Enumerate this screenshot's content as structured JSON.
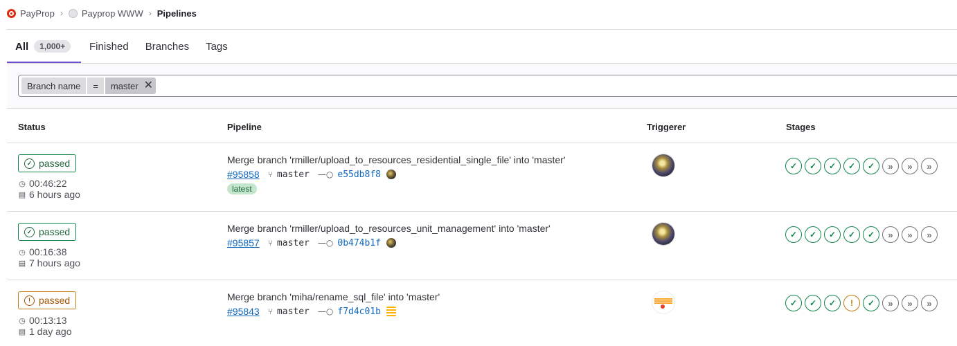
{
  "breadcrumb": {
    "group": "PayProp",
    "project": "Payprop WWW",
    "current": "Pipelines"
  },
  "tabs": [
    {
      "label": "All",
      "count": "1,000+"
    },
    {
      "label": "Finished"
    },
    {
      "label": "Branches"
    },
    {
      "label": "Tags"
    }
  ],
  "filter": {
    "token_name": "Branch name",
    "operator": "=",
    "value": "master"
  },
  "table": {
    "headers": {
      "status": "Status",
      "pipeline": "Pipeline",
      "triggerer": "Triggerer",
      "stages": "Stages"
    },
    "rows": [
      {
        "status": "passed",
        "duration": "00:46:22",
        "finished": "6 hours ago",
        "title": "Merge branch 'rmiller/upload_to_resources_residential_single_file' into 'master'",
        "id": "#95858",
        "branch": "master",
        "sha": "e55db8f8",
        "badge": "latest"
      },
      {
        "status": "passed",
        "duration": "00:16:38",
        "finished": "7 hours ago",
        "title": "Merge branch 'rmiller/upload_to_resources_unit_management' into 'master'",
        "id": "#95857",
        "branch": "master",
        "sha": "0b474b1f"
      },
      {
        "status": "passed",
        "duration": "00:13:13",
        "finished": "1 day ago",
        "title": "Merge branch 'miha/rename_sql_file' into 'master'",
        "id": "#95843",
        "branch": "master",
        "sha": "f7d4c01b"
      }
    ]
  },
  "icons": {
    "success": "check-circle-icon",
    "warning": "warning-circle-icon",
    "skipped": "skipped-icon",
    "timer": "timer-icon",
    "calendar": "calendar-icon",
    "branch": "branch-icon",
    "commit": "commit-icon"
  },
  "colors": {
    "success": "#108548",
    "warning": "#c17d10",
    "skipped": "#737278",
    "link": "#1068bf",
    "tab_active": "#6e49cb"
  }
}
